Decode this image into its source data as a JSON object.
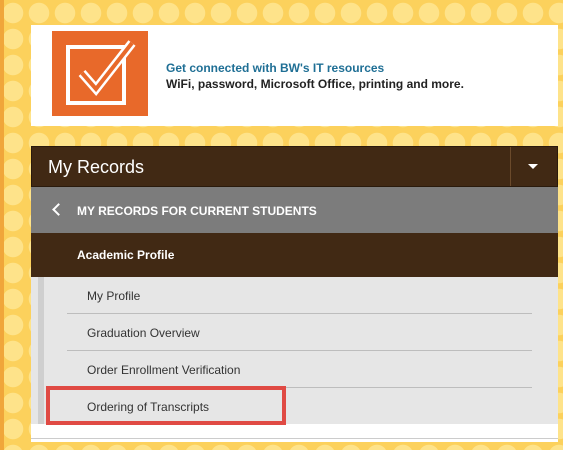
{
  "banner": {
    "title": "Get connected with BW's IT resources",
    "subtitle": "WiFi, password, Microsoft Office, printing and more.",
    "logo_icon": "checkbox-icon",
    "logo_color": "#e8692a"
  },
  "records": {
    "title": "My Records",
    "toggle_icon": "caret-down-icon",
    "back_label": "MY RECORDS FOR CURRENT STUDENTS",
    "section_label": "Academic Profile",
    "items": [
      {
        "label": "My Profile"
      },
      {
        "label": "Graduation Overview"
      },
      {
        "label": "Order Enrollment Verification"
      },
      {
        "label": "Ordering of Transcripts"
      }
    ],
    "highlighted_item": "Ordering of Transcripts",
    "highlight_color": "#e04a44",
    "header_color": "#412914"
  }
}
